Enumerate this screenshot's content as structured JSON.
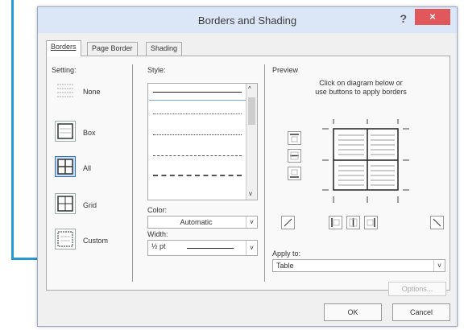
{
  "dialog": {
    "title": "Borders and Shading",
    "help_glyph": "?",
    "close_glyph": "×"
  },
  "tabs": [
    {
      "label": "Borders",
      "active": true
    },
    {
      "label": "Page Border",
      "active": false
    },
    {
      "label": "Shading",
      "active": false
    }
  ],
  "setting": {
    "heading": "Setting:",
    "options": [
      {
        "label": "None",
        "selected": false
      },
      {
        "label": "Box",
        "selected": false
      },
      {
        "label": "All",
        "selected": true
      },
      {
        "label": "Grid",
        "selected": false
      },
      {
        "label": "Custom",
        "selected": false
      }
    ]
  },
  "style": {
    "heading": "Style:"
  },
  "color": {
    "label": "Color:",
    "value": "Automatic"
  },
  "width": {
    "label": "Width:",
    "value": "½ pt"
  },
  "preview": {
    "heading": "Preview",
    "instruction_1": "Click on diagram below or",
    "instruction_2": "use buttons to apply borders"
  },
  "apply_to": {
    "label": "Apply to:",
    "value": "Table"
  },
  "buttons": {
    "options": "Options...",
    "ok": "OK",
    "cancel": "Cancel"
  },
  "colors": {
    "callout": "#2a98d0",
    "close": "#e0585b",
    "titlebar": "#dbe7f6"
  }
}
